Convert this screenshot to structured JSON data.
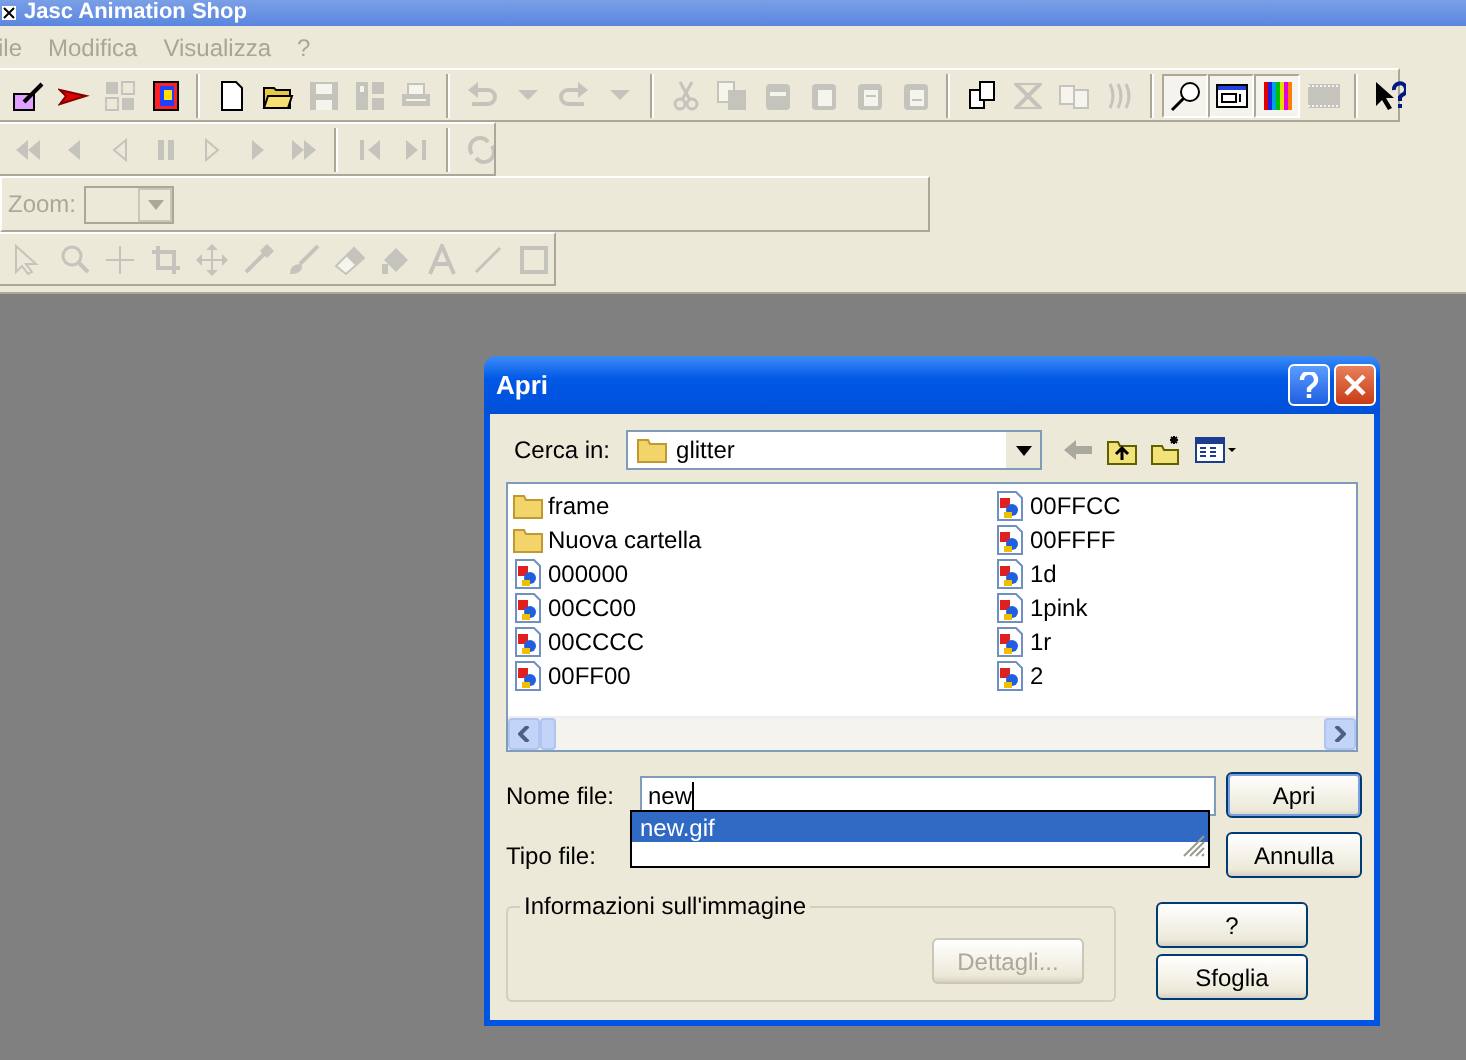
{
  "window": {
    "title": "Jasc Animation Shop"
  },
  "menu": [
    "ile",
    "Modifica",
    "Visualizza",
    "?"
  ],
  "toolbars": [
    {
      "groups": [
        [
          {
            "disabled": false,
            "pressed": false
          },
          {
            "disabled": false,
            "pressed": false
          },
          {
            "disabled": true,
            "pressed": false
          },
          {
            "disabled": false,
            "pressed": false
          }
        ],
        [
          {
            "disabled": false,
            "pressed": false
          },
          {
            "disabled": false,
            "pressed": false
          },
          {
            "disabled": true,
            "pressed": false
          },
          {
            "disabled": true,
            "pressed": false
          },
          {
            "disabled": true,
            "pressed": false
          }
        ],
        [
          {
            "disabled": true,
            "pressed": false
          },
          {
            "disabled": true,
            "pressed": false
          },
          {
            "disabled": true,
            "pressed": false
          },
          {
            "disabled": true,
            "pressed": false
          }
        ],
        [
          {
            "disabled": true,
            "pressed": false
          },
          {
            "disabled": true,
            "pressed": false
          },
          {
            "disabled": true,
            "pressed": false
          },
          {
            "disabled": true,
            "pressed": false
          },
          {
            "disabled": true,
            "pressed": false
          },
          {
            "disabled": true,
            "pressed": false
          }
        ],
        [
          {
            "disabled": false,
            "pressed": false
          },
          {
            "disabled": true,
            "pressed": false
          },
          {
            "disabled": true,
            "pressed": false
          },
          {
            "disabled": true,
            "pressed": false
          }
        ],
        [
          {
            "disabled": false,
            "pressed": true
          },
          {
            "disabled": false,
            "pressed": true
          },
          {
            "disabled": false,
            "pressed": true
          },
          {
            "disabled": true,
            "pressed": false
          }
        ],
        [
          {
            "disabled": false,
            "pressed": false
          }
        ]
      ]
    },
    {
      "groups": [
        [
          {
            "disabled": true,
            "pressed": false
          },
          {
            "disabled": true,
            "pressed": false
          },
          {
            "disabled": true,
            "pressed": false
          },
          {
            "disabled": true,
            "pressed": false
          },
          {
            "disabled": true,
            "pressed": false
          },
          {
            "disabled": true,
            "pressed": false
          },
          {
            "disabled": true,
            "pressed": false
          }
        ],
        [
          {
            "disabled": true,
            "pressed": false
          },
          {
            "disabled": true,
            "pressed": false
          }
        ],
        [
          {
            "disabled": true,
            "pressed": false
          }
        ]
      ]
    },
    {
      "groups": [
        [
          {
            "disabled": true,
            "pressed": false
          },
          {
            "disabled": true,
            "pressed": false
          },
          {
            "disabled": true,
            "pressed": false
          },
          {
            "disabled": true,
            "pressed": false
          },
          {
            "disabled": true,
            "pressed": false
          },
          {
            "disabled": true,
            "pressed": false
          },
          {
            "disabled": true,
            "pressed": false
          },
          {
            "disabled": true,
            "pressed": false
          },
          {
            "disabled": true,
            "pressed": false
          },
          {
            "disabled": true,
            "pressed": false
          },
          {
            "disabled": true,
            "pressed": false
          },
          {
            "disabled": true,
            "pressed": false
          }
        ]
      ]
    }
  ],
  "zoom_bar": {
    "label": "Zoom:",
    "disabled": true
  },
  "dialog": {
    "title": "Apri",
    "look_in": {
      "label": "Cerca in:",
      "value": "glitter"
    },
    "files": [
      {
        "name": "frame",
        "kind": "folder"
      },
      {
        "name": "Nuova cartella",
        "kind": "folder"
      },
      {
        "name": "000000",
        "kind": "image"
      },
      {
        "name": "00CC00",
        "kind": "image"
      },
      {
        "name": "00CCCC",
        "kind": "image"
      },
      {
        "name": "00FF00",
        "kind": "image"
      },
      {
        "name": "00FFCC",
        "kind": "image"
      },
      {
        "name": "00FFFF",
        "kind": "image"
      },
      {
        "name": "1d",
        "kind": "image"
      },
      {
        "name": "1pink",
        "kind": "image"
      },
      {
        "name": "1r",
        "kind": "image"
      },
      {
        "name": "2",
        "kind": "image"
      }
    ],
    "file_name": {
      "label": "Nome file:",
      "value": "new"
    },
    "autocomplete": [
      {
        "text": "new.gif",
        "selected": true
      }
    ],
    "file_type": {
      "label": "Tipo file:"
    },
    "buttons": [
      {
        "label": "Apri",
        "default": true
      },
      {
        "label": "Annulla",
        "default": false
      }
    ],
    "image_info": {
      "label": "Informazioni sull'immagine",
      "button": {
        "label": "Dettagli...",
        "disabled": true
      }
    },
    "side_buttons": [
      {
        "label": "?"
      },
      {
        "label": "Sfoglia"
      }
    ]
  }
}
